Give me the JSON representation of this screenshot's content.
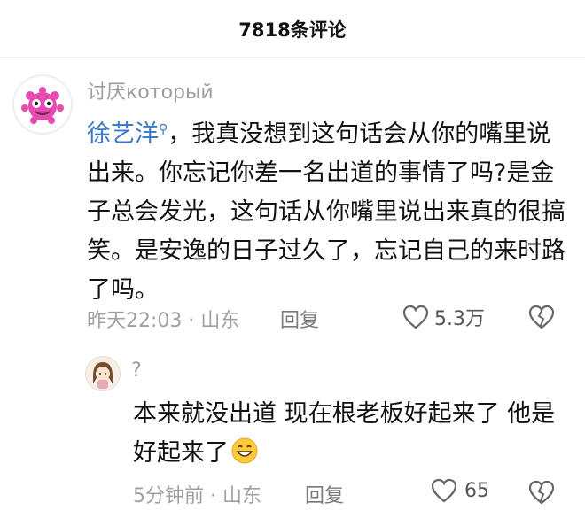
{
  "header": {
    "title": "7818条评论"
  },
  "comments": [
    {
      "username": "讨厌который",
      "mention": "徐艺洋",
      "text": "，我真没想到这句话会从你的嘴里说出来。你忘记你差一名出道的事情了吗?是金子总会发光，这句话从你嘴里说出来真的很搞笑。是安逸的日子过久了，忘记自己的来时路了吗。",
      "time": "昨天22:03",
      "location": "山东",
      "reply_label": "回复",
      "likes": "5.3万",
      "avatar_icon": "pink-monster-avatar"
    },
    {
      "username": "?",
      "text": "本来就没出道 现在根老板好起来了 他是好起来了",
      "emoji": "grinning-face-emoji",
      "time": "5分钟前",
      "location": "山东",
      "reply_label": "回复",
      "likes": "65",
      "avatar_icon": "cartoon-girl-avatar"
    }
  ],
  "separator": " · ",
  "colors": {
    "mention": "#3c79c8",
    "muted": "#a0a0a0",
    "text": "#111111"
  }
}
